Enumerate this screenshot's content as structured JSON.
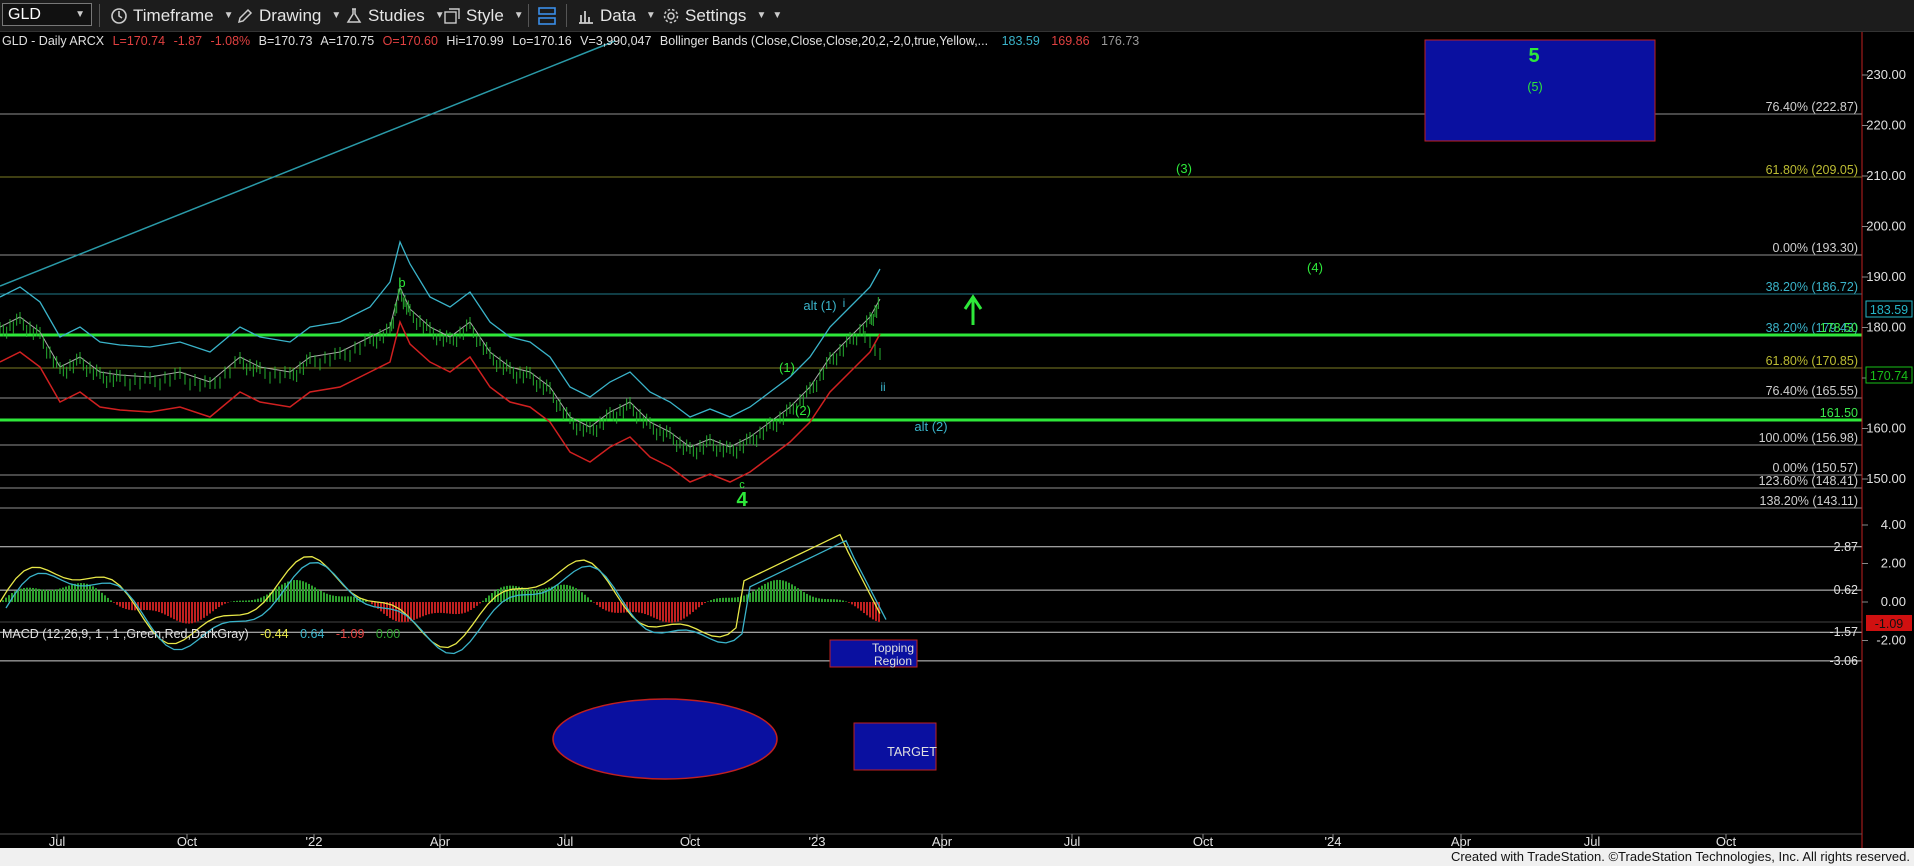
{
  "toolbar": {
    "symbol": "GLD",
    "timeframe": "Timeframe",
    "drawing": "Drawing",
    "studies": "Studies",
    "style": "Style",
    "data": "Data",
    "settings": "Settings"
  },
  "header": {
    "name": "GLD - Daily  ARCX",
    "last": "L=170.74",
    "change": "-1.87",
    "change_pct": "-1.08%",
    "bid": "B=170.73",
    "ask": "A=170.75",
    "open": "O=170.60",
    "high": "Hi=170.99",
    "low": "Lo=170.16",
    "volume": "V=3,990,047",
    "study": "Bollinger Bands (Close,Close,Close,20,2,-2,0,true,Yellow,...",
    "bb_upper": "183.59",
    "bb_lower": "169.86",
    "bb_mid": "176.73"
  },
  "macd_header": {
    "name": "MACD (12,26,9, 1 , 1 ,Green,Red,DarkGray)",
    "v1": "-0.44",
    "v2": "0.64",
    "v3": "-1.09",
    "v4": "0.00"
  },
  "price_axis": {
    "ticks": [
      "230.00",
      "220.00",
      "210.00",
      "200.00",
      "190.00",
      "180.00",
      "170.00",
      "160.00",
      "150.00"
    ],
    "current_tags": [
      {
        "label": "183.59",
        "color": "#26b6c8"
      },
      {
        "label": "170.74",
        "color": "#18c018"
      }
    ]
  },
  "macd_axis": {
    "ticks": [
      "4.00",
      "2.00",
      "0.00",
      "-2.00"
    ],
    "levels": [
      "2.87",
      "0.62",
      "-1.57",
      "-3.06"
    ],
    "current_tag": "-1.09"
  },
  "time_axis": [
    "Jul",
    "Oct",
    "'22",
    "Apr",
    "Jul",
    "Oct",
    "'23",
    "Apr",
    "Jul",
    "Oct",
    "'24",
    "Apr",
    "Jul",
    "Oct"
  ],
  "fib_levels": [
    {
      "label": "76.40% (222.87)",
      "color": "#d0d0d0"
    },
    {
      "label": "61.80% (209.05)",
      "color": "#bdbd33"
    },
    {
      "label": "0.00% (193.30)",
      "color": "#d0d0d0"
    },
    {
      "label": "38.20% (186.72)",
      "color": "#3ab3c9"
    },
    {
      "label": "38.20% (179.43)",
      "color": "#3ab3c9"
    },
    {
      "label": "178.50",
      "color": "#3ae84a"
    },
    {
      "label": "61.80% (170.85)",
      "color": "#bdbd33"
    },
    {
      "label": "76.40% (165.55)",
      "color": "#d0d0d0"
    },
    {
      "label": "161.50",
      "color": "#3ae84a"
    },
    {
      "label": "100.00% (156.98)",
      "color": "#d0d0d0"
    },
    {
      "label": "0.00% (150.57)",
      "color": "#d0d0d0"
    },
    {
      "label": "123.60% (148.41)",
      "color": "#d0d0d0"
    },
    {
      "label": "138.20% (143.11)",
      "color": "#d0d0d0"
    }
  ],
  "wave_labels": {
    "w5": "5",
    "w5_sub": "(5)",
    "w3": "(3)",
    "w4_sub": "(4)",
    "b": "b",
    "alt1": "alt (1)",
    "i": "i",
    "ii": "ii",
    "w1": "(1)",
    "w2": "(2)",
    "alt2": "alt (2)",
    "c": "c",
    "w4": "4"
  },
  "annotations": {
    "topping": "Topping Region",
    "target": "TARGET"
  },
  "footer": {
    "credit": "Created with TradeStation. ©TradeStation Technologies, Inc. All rights reserved."
  }
}
